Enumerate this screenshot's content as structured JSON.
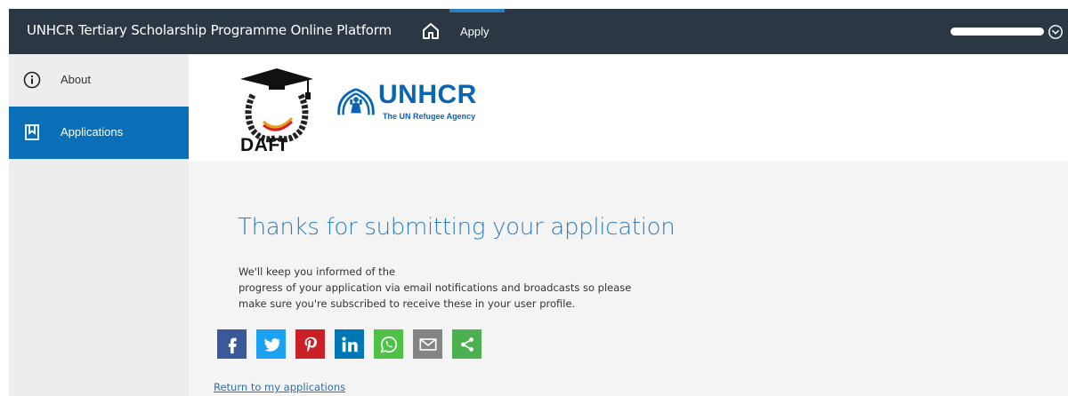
{
  "topbar": {
    "app_title": "UNHCR Tertiary Scholarship Programme Online Platform",
    "home_icon": "home-icon",
    "apply_label": "Apply",
    "user_icon": "user-circle-icon",
    "accent_color": "#2f7fbd",
    "background_color": "#2b3742"
  },
  "sidebar": {
    "items": [
      {
        "label": "About",
        "icon": "info-circle-icon",
        "active": false
      },
      {
        "label": "Applications",
        "icon": "bookmark-icon",
        "active": true
      }
    ],
    "active_color": "#0a6fb6"
  },
  "banner": {
    "dafi_logo_text": "DAFI",
    "unhcr_logo_text": "UNHCR",
    "unhcr_tagline": "The UN Refugee Agency"
  },
  "main": {
    "heading": "Thanks for submitting your application",
    "message_lines": [
      "We'll keep you informed of the",
      "progress of your application via email notifications and broadcasts so please",
      "make sure you're subscribed to receive these in your user profile."
    ],
    "share_buttons": [
      {
        "name": "facebook-icon",
        "color": "#3b5998"
      },
      {
        "name": "twitter-icon",
        "color": "#1da1f2"
      },
      {
        "name": "pinterest-icon",
        "color": "#cb2027"
      },
      {
        "name": "linkedin-icon",
        "color": "#0077b5"
      },
      {
        "name": "whatsapp-icon",
        "color": "#4dc247"
      },
      {
        "name": "email-icon",
        "color": "#848484"
      },
      {
        "name": "sharethis-icon",
        "color": "#4caf50"
      }
    ],
    "return_link": "Return to my applications"
  }
}
